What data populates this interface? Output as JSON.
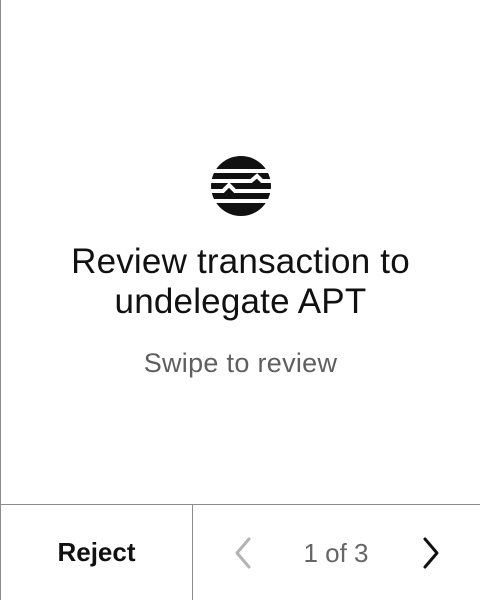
{
  "review": {
    "title": "Review transaction to undelegate APT",
    "subtitle": "Swipe to review",
    "logo_icon": "aptos-logo-icon"
  },
  "footer": {
    "reject_label": "Reject",
    "page_indicator": "1 of 3",
    "prev_icon": "chevron-left-icon",
    "next_icon": "chevron-right-icon"
  },
  "colors": {
    "background": "#ffffff",
    "text": "#111111",
    "muted_text": "#5f5f5f",
    "divider": "#8c8c8c",
    "disabled_icon": "#b3b3b3"
  }
}
